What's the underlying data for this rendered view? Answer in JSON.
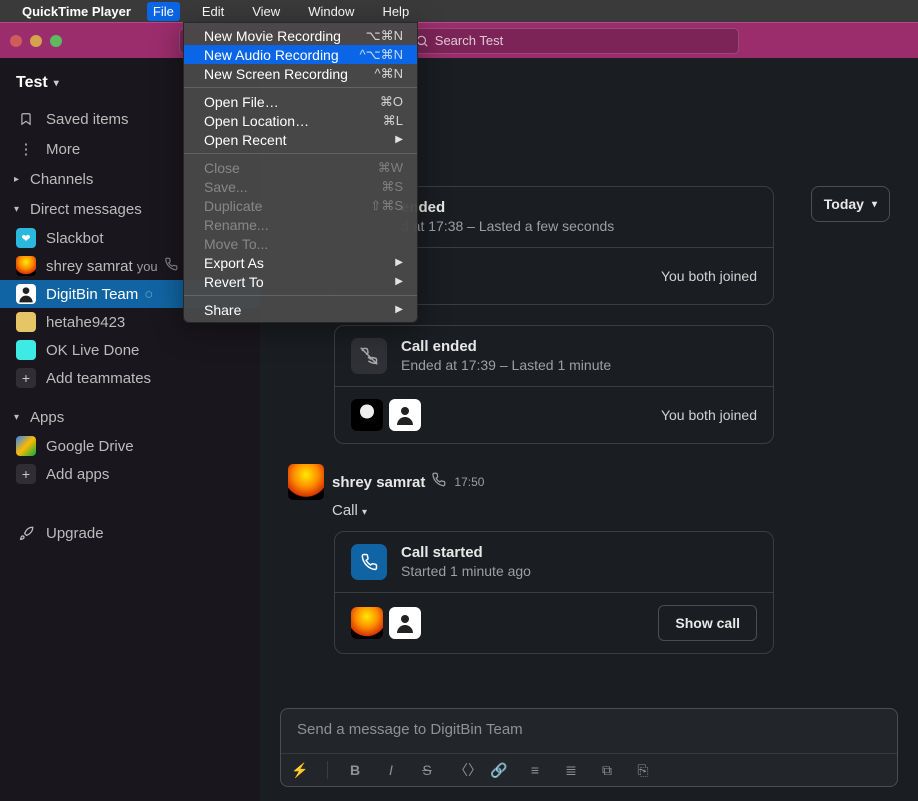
{
  "menubar": {
    "app": "QuickTime Player",
    "items": [
      "File",
      "Edit",
      "View",
      "Window",
      "Help"
    ]
  },
  "file_menu": {
    "items": [
      {
        "label": "New Movie Recording",
        "shortcut": "⌥⌘N",
        "enabled": true,
        "highlight": false
      },
      {
        "label": "New Audio Recording",
        "shortcut": "^⌥⌘N",
        "enabled": true,
        "highlight": true
      },
      {
        "label": "New Screen Recording",
        "shortcut": "^⌘N",
        "enabled": true,
        "highlight": false
      }
    ],
    "items2": [
      {
        "label": "Open File…",
        "shortcut": "⌘O",
        "enabled": true
      },
      {
        "label": "Open Location…",
        "shortcut": "⌘L",
        "enabled": true
      },
      {
        "label": "Open Recent",
        "submenu": true,
        "enabled": true
      }
    ],
    "items3": [
      {
        "label": "Close",
        "shortcut": "⌘W",
        "enabled": false
      },
      {
        "label": "Save...",
        "shortcut": "⌘S",
        "enabled": false
      },
      {
        "label": "Duplicate",
        "shortcut": "⇧⌘S",
        "enabled": false
      },
      {
        "label": "Rename...",
        "enabled": false
      },
      {
        "label": "Move To...",
        "enabled": false
      },
      {
        "label": "Export As",
        "submenu": true,
        "enabled": true
      },
      {
        "label": "Revert To",
        "submenu": true,
        "enabled": true
      }
    ],
    "items4": [
      {
        "label": "Share",
        "submenu": true,
        "enabled": true
      }
    ]
  },
  "slack": {
    "search_placeholder": "Search Test",
    "workspace": "Test"
  },
  "sidebar": {
    "saved": "Saved items",
    "more": "More",
    "channels": "Channels",
    "direct_messages": "Direct messages",
    "dms": [
      {
        "name": "Slackbot"
      },
      {
        "name": "shrey samrat",
        "you": "you",
        "call": true
      },
      {
        "name": "DigitBin Team",
        "active": true,
        "away": true
      },
      {
        "name": "hetahe9423"
      },
      {
        "name": "OK Live Done"
      }
    ],
    "add_teammates": "Add teammates",
    "apps": "Apps",
    "app_items": [
      {
        "name": "Google Drive"
      }
    ],
    "add_apps": "Add apps",
    "upgrade": "Upgrade"
  },
  "today_label": "Today",
  "calls": [
    {
      "title": "ended",
      "sub": "d at 17:38 – Lasted a few seconds",
      "footer": "You both joined",
      "ended": true
    },
    {
      "title": "Call ended",
      "sub": "Ended at 17:39 – Lasted 1 minute",
      "footer": "You both joined",
      "ended": true
    }
  ],
  "message": {
    "author": "shrey samrat",
    "time": "17:50",
    "body": "Call"
  },
  "active_call": {
    "title": "Call started",
    "sub": "Started 1 minute ago",
    "show_call": "Show call"
  },
  "composer": {
    "placeholder": "Send a message to DigitBin Team"
  }
}
